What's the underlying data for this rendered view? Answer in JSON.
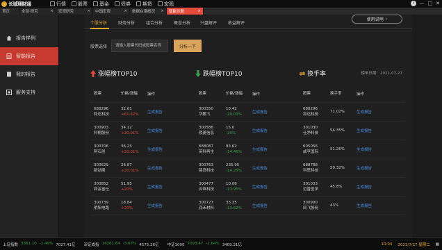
{
  "app": {
    "name": "长城理财通",
    "logo_color": "#e0a62b"
  },
  "menu": [
    {
      "icon": "chart-icon",
      "label": "行情"
    },
    {
      "icon": "stock-icon",
      "label": "股票"
    },
    {
      "icon": "fund-icon",
      "label": "基金"
    },
    {
      "icon": "bond-icon",
      "label": "债券"
    },
    {
      "icon": "futures-icon",
      "label": "期货"
    },
    {
      "icon": "macro-icon",
      "label": "宏观"
    }
  ],
  "tabs": [
    {
      "label": "首页",
      "active": false
    },
    {
      "label": "全部·研究",
      "active": false
    },
    {
      "label": "宏观研究",
      "active": false
    },
    {
      "label": "中国宏观",
      "active": false
    },
    {
      "label": "数据在港概况",
      "active": false
    },
    {
      "label": "智能诊股",
      "active": true
    }
  ],
  "sidebar": [
    {
      "icon": "home-icon",
      "label": "报告样例",
      "active": false
    },
    {
      "icon": "report-icon",
      "label": "智能报告",
      "active": true
    },
    {
      "icon": "my-report-icon",
      "label": "我的报告",
      "active": false
    },
    {
      "icon": "support-icon",
      "label": "服务支持",
      "active": false
    }
  ],
  "subtabs": [
    "个股分析",
    "财务分析",
    "组合分析",
    "概念分析",
    "兴盘解评",
    "收益解评"
  ],
  "help_button": "使用说明",
  "search": {
    "label": "股票选择",
    "placeholder": "请输入股票代码或股票名称",
    "button": "分析一下"
  },
  "date_label": "榜单日期：2021-07-27",
  "columns": {
    "gainers": {
      "title": "涨幅榜TOP10",
      "headers": [
        "股票",
        "价格/涨幅",
        "操作"
      ],
      "rows": [
        {
          "code": "688296",
          "name": "和达科技",
          "price": "32.61",
          "chg": "+61.62%"
        },
        {
          "code": "300903",
          "name": "科翔股份",
          "price": "34.12",
          "chg": "+20.01%"
        },
        {
          "code": "300706",
          "name": "阿石创",
          "price": "36.23",
          "chg": "+20.01%"
        },
        {
          "code": "300629",
          "name": "新劲刚",
          "price": "26.87",
          "chg": "+20.01%"
        },
        {
          "code": "300852",
          "name": "四会富仕",
          "price": "51.95",
          "chg": "+20%"
        },
        {
          "code": "300739",
          "name": "明阳电路",
          "price": "18.84",
          "chg": "+20%"
        }
      ]
    },
    "losers": {
      "title": "跌幅榜TOP10",
      "headers": [
        "股票",
        "价格/涨幅",
        "操作"
      ],
      "rows": [
        {
          "code": "300350",
          "name": "华鹏飞",
          "price": "10.42",
          "chg": "-20.03%"
        },
        {
          "code": "300588",
          "name": "熙菱信息",
          "price": "15.0",
          "chg": "-20%"
        },
        {
          "code": "688087",
          "name": "英科再生",
          "price": "93.62",
          "chg": "-14.46%"
        },
        {
          "code": "300763",
          "name": "锦浪科技",
          "price": "235.95",
          "chg": "-14.25%"
        },
        {
          "code": "300477",
          "name": "合纵科技",
          "price": "10.06",
          "chg": "-13.95%"
        },
        {
          "code": "300727",
          "name": "润禾材料",
          "price": "33.35",
          "chg": "-13.62%"
        }
      ]
    },
    "turnover": {
      "title": "换手率",
      "headers": [
        "股票",
        "换手率",
        "操作"
      ],
      "rows": [
        {
          "code": "688296",
          "name": "和达科技",
          "rate": "71.02%"
        },
        {
          "code": "301030",
          "name": "仕净科技",
          "rate": "54.35%"
        },
        {
          "code": "605056",
          "name": "咸亨国际",
          "rate": "51.26%"
        },
        {
          "code": "688788",
          "name": "科思科技",
          "rate": "50.32%"
        },
        {
          "code": "301033",
          "name": "迈普医学",
          "rate": "45.8%"
        },
        {
          "code": "300990",
          "name": "同飞股份",
          "rate": "43%"
        }
      ]
    }
  },
  "op_label": "生成报告",
  "indices": [
    {
      "name": "上证指数",
      "value": "3361.10",
      "chg": "-2.49%",
      "extra": "7027.41亿"
    },
    {
      "name": "深证成指",
      "value": "14261.64",
      "chg": "-3.67%",
      "extra": "4575.26亿"
    },
    {
      "name": "中证1000",
      "value": "7093.47",
      "chg": "-2.64%",
      "extra": "3409.31亿"
    }
  ],
  "clock": {
    "time": "10:04",
    "date": "2021/7/27 星期二"
  },
  "colors": {
    "up": "#e04a3b",
    "down": "#3ca24a",
    "accent": "#e0a62b",
    "link": "#4a8de0",
    "active_tab": "#e44b3b"
  }
}
